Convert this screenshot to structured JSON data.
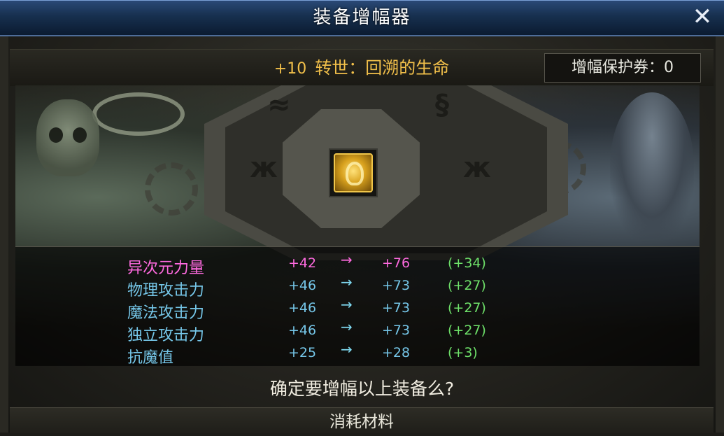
{
  "window": {
    "title": "装备增幅器"
  },
  "item": {
    "level": "+10",
    "name": "转世：回溯的生命"
  },
  "protection": {
    "label": "增幅保护券：0"
  },
  "stats": [
    {
      "name": "异次元力量",
      "from": "+42",
      "arrow": "→",
      "to": "+76",
      "delta": "(+34)",
      "special": true
    },
    {
      "name": "物理攻击力",
      "from": "+46",
      "arrow": "→",
      "to": "+73",
      "delta": "(+27)",
      "special": false
    },
    {
      "name": "魔法攻击力",
      "from": "+46",
      "arrow": "→",
      "to": "+73",
      "delta": "(+27)",
      "special": false
    },
    {
      "name": "独立攻击力",
      "from": "+46",
      "arrow": "→",
      "to": "+73",
      "delta": "(+27)",
      "special": false
    },
    {
      "name": "抗魔值",
      "from": "+25",
      "arrow": "→",
      "to": "+28",
      "delta": "(+3)",
      "special": false
    }
  ],
  "confirm": {
    "text": "确定要增幅以上装备么?"
  },
  "material": {
    "label": "消耗材料"
  },
  "icons": {
    "close": "close-icon",
    "item": "golden-ring-item-icon"
  },
  "colors": {
    "title_bar": "#17304f",
    "item_name": "#f2c04a",
    "stat": "#75c6e8",
    "special_stat": "#ff6ae0",
    "delta": "#6fe26a"
  }
}
